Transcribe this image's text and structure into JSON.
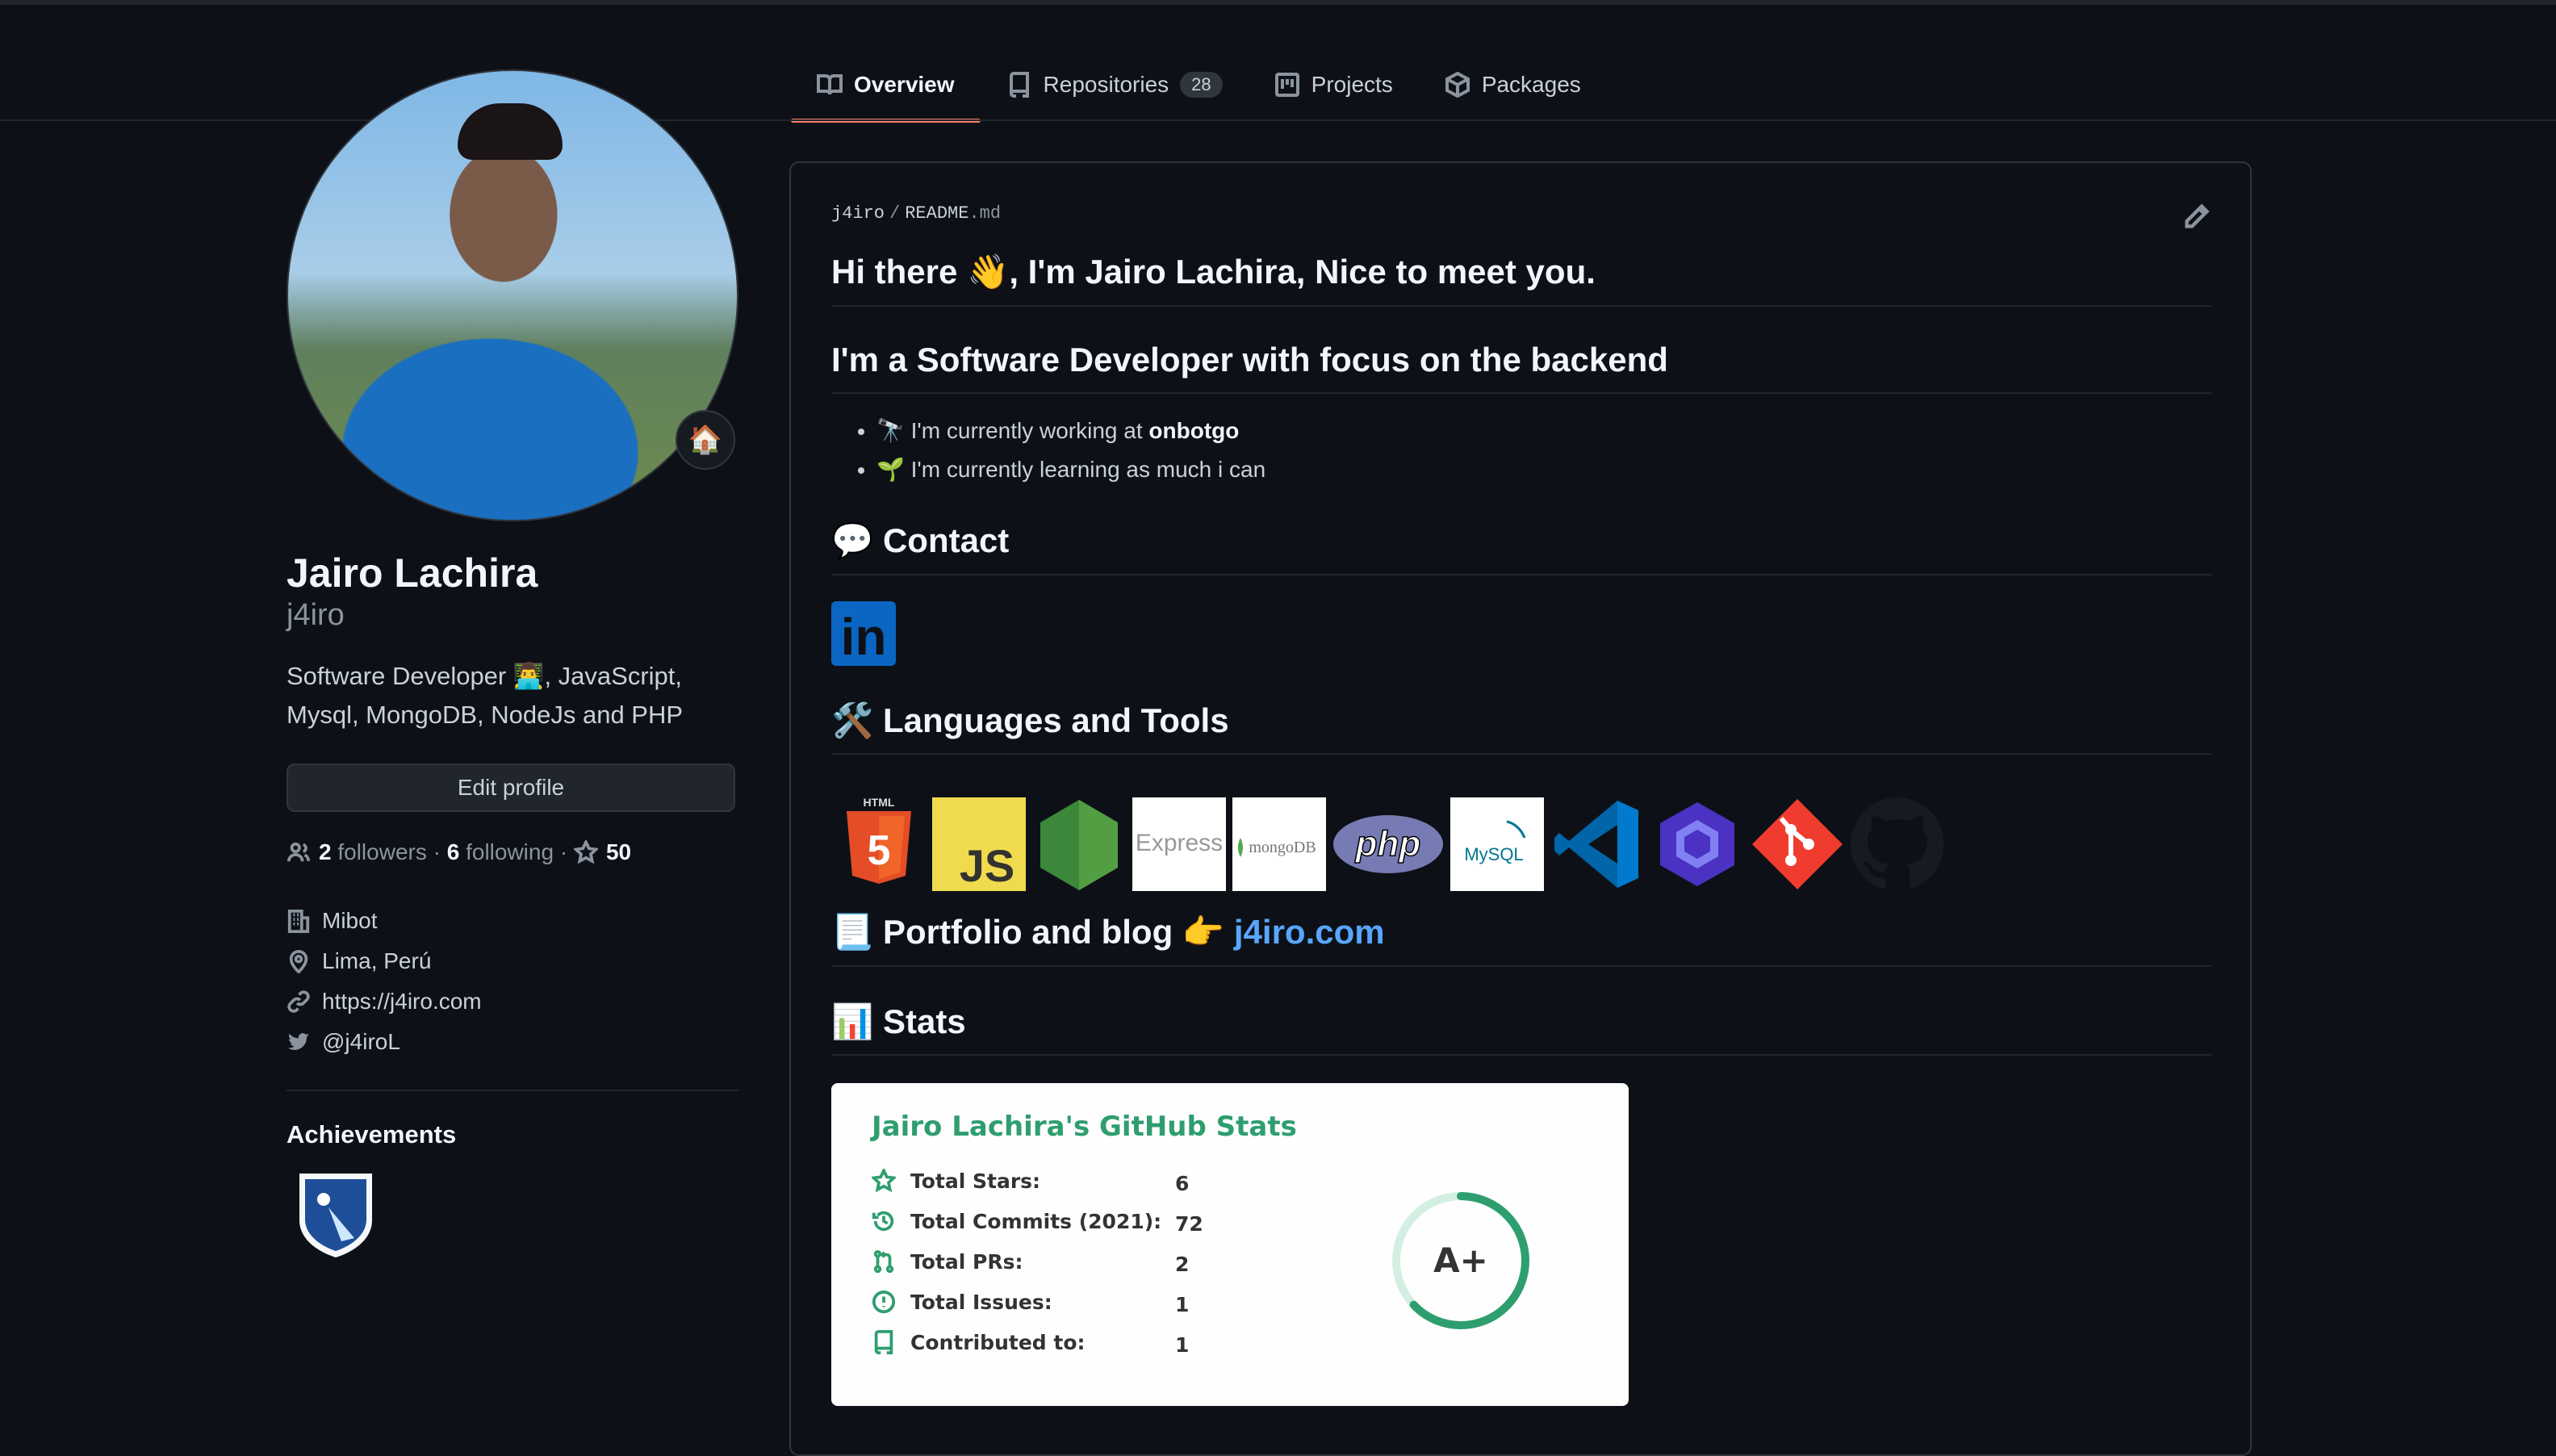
{
  "tabs": [
    {
      "label": "Overview",
      "icon": "book-icon",
      "active": true
    },
    {
      "label": "Repositories",
      "icon": "repo-icon",
      "count": "28"
    },
    {
      "label": "Projects",
      "icon": "project-icon"
    },
    {
      "label": "Packages",
      "icon": "package-icon"
    }
  ],
  "profile": {
    "name": "Jairo Lachira",
    "login": "j4iro",
    "status_emoji": "🏠",
    "bio_line1": "Software Developer 👨‍💻, JavaScript,",
    "bio_line2": "Mysql, MongoDB, NodeJs and PHP",
    "edit_label": "Edit profile",
    "followers_count": "2",
    "followers_label": "followers",
    "following_count": "6",
    "following_label": "following",
    "dot": "·",
    "stars_count": "50",
    "company": "Mibot",
    "location": "Lima, Perú",
    "website": "https://j4iro.com",
    "twitter": "@j4iroL",
    "achievements_title": "Achievements"
  },
  "readme": {
    "path_owner": "j4iro",
    "path_sep": "/",
    "path_file": "README",
    "path_ext": ".md",
    "h1": "Hi there 👋, I'm Jairo Lachira, Nice to meet you.",
    "h2": "I'm a Software Developer with focus on the backend",
    "bullet1_text": "🔭 I'm currently working at ",
    "bullet1_bold": "onbotgo",
    "bullet2_text": "🌱 I'm currently learning as much i can",
    "contact_heading": "💬 Contact",
    "linkedin_text": "in",
    "tools_heading": "🛠️ Languages and Tools",
    "tools": [
      {
        "name": "html5",
        "label": "HTML",
        "glyph": "5"
      },
      {
        "name": "javascript",
        "label": "JS"
      },
      {
        "name": "nodejs"
      },
      {
        "name": "express",
        "label": "Express"
      },
      {
        "name": "mongodb",
        "label": "mongoDB"
      },
      {
        "name": "php",
        "label": "php"
      },
      {
        "name": "mysql",
        "label": "MySQL"
      },
      {
        "name": "vscode"
      },
      {
        "name": "eslint"
      },
      {
        "name": "git"
      },
      {
        "name": "github"
      }
    ],
    "portfolio_heading": "📃 Portfolio and blog 👉 ",
    "portfolio_link": "j4iro.com",
    "stats_heading": "📊 Stats"
  },
  "stats_card": {
    "title": "Jairo Lachira's GitHub Stats",
    "rows": [
      {
        "label": "Total Stars:",
        "value": "6",
        "icon": "star-icon"
      },
      {
        "label": "Total Commits (2021):",
        "value": "72",
        "icon": "history-icon"
      },
      {
        "label": "Total PRs:",
        "value": "2",
        "icon": "pull-request-icon"
      },
      {
        "label": "Total Issues:",
        "value": "1",
        "icon": "issue-icon"
      },
      {
        "label": "Contributed to:",
        "value": "1",
        "icon": "repo-icon"
      }
    ],
    "rank": "A+",
    "rank_progress": 0.63,
    "accent": "#2f9e6f"
  },
  "colors": {
    "background": "#0d1117",
    "border": "#30363d",
    "link": "#58a6ff",
    "tab_active": "#f78166"
  }
}
